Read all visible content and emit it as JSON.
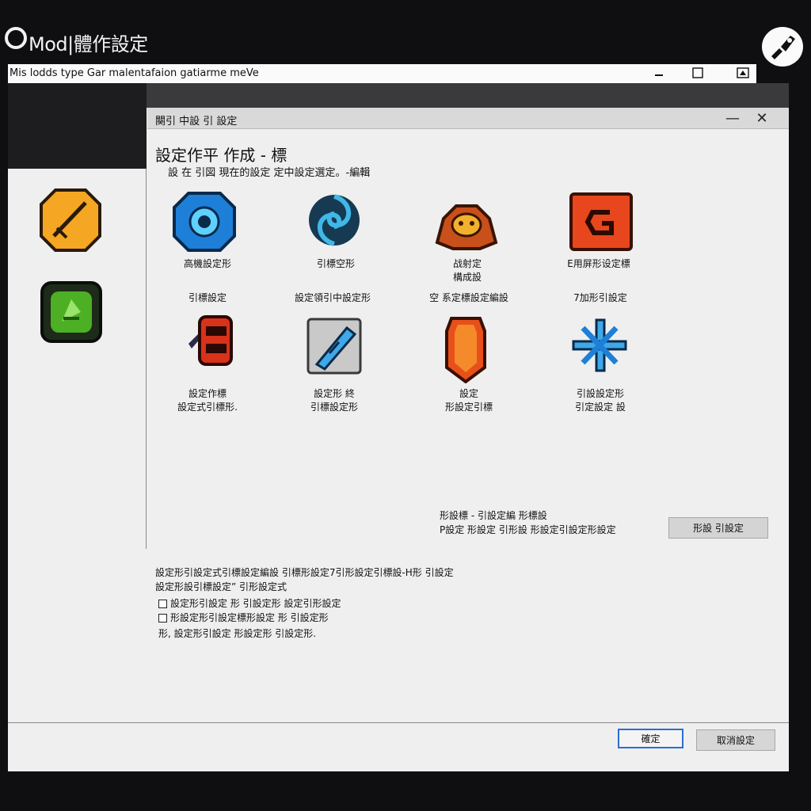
{
  "app": {
    "title": "Mod|體作設定",
    "icons": {
      "logo": "ring-logo-icon",
      "brand": "brush-badge-icon"
    }
  },
  "window": {
    "title": "Mis lodds type Gar malentafaion gatiarme meVe",
    "controls": {
      "minimize": "—",
      "maximize": "□",
      "restore": "▣"
    }
  },
  "sidebar": {
    "items": [
      {
        "icon": "sword-icon",
        "color": "#f5a623"
      },
      {
        "icon": "green-gem-icon",
        "color": "#4caf24"
      }
    ]
  },
  "dialog": {
    "title": "闋引 中設 引 設定",
    "minimize": "—",
    "close": "✕",
    "heading": "設定作平 作成 - 標",
    "subheading": "設 在 引図 現在的設定 定中設定選定。-編輯",
    "mods": [
      {
        "icon": "blue-crest-icon",
        "label": "高機設定形"
      },
      {
        "icon": "vortex-icon",
        "label": "引標空形"
      },
      {
        "icon": "golden-crab-icon",
        "label": "战射定\n構成設"
      },
      {
        "icon": "red-g-icon",
        "label": "E用屏形设定標"
      },
      {
        "icon": "",
        "label": "引標設定"
      },
      {
        "icon": "",
        "label": "設定領引中設定形"
      },
      {
        "icon": "",
        "label": "空 系定標設定編設"
      },
      {
        "icon": "",
        "label": "7加形引設定"
      },
      {
        "icon": "red-gauntlet-icon",
        "label": "設定作標\n設定式引標形."
      },
      {
        "icon": "blue-wrench-icon",
        "label": "設定形 終\n引標設定形"
      },
      {
        "icon": "red-crystal-icon",
        "label": "設定\n形設定引標"
      },
      {
        "icon": "blue-snowflake-icon",
        "label": "引設設定形\n引定設定 設"
      }
    ],
    "info": "形設標 - 引設定編 形標設\nP設定 形設定 引形設 形設定引設定形設定",
    "apply_label": "形設 引設定",
    "description": "設定形引設定式引標設定編設 引標形設定7引形設定引標設-H形 引設定\n設定形設引標設定” 引形設定式",
    "options": [
      "設定形引設定 形 引設定形 設定引形設定",
      "形設定形引設定標形設定 形 引設定形"
    ],
    "note": "形, 設定形引設定 形設定形 引設定形."
  },
  "footer": {
    "ok_label": "確定",
    "cancel_label": "取消設定"
  },
  "colors": {
    "focus_outline": "#2a6fd1",
    "dialog_bg": "#efefef"
  }
}
